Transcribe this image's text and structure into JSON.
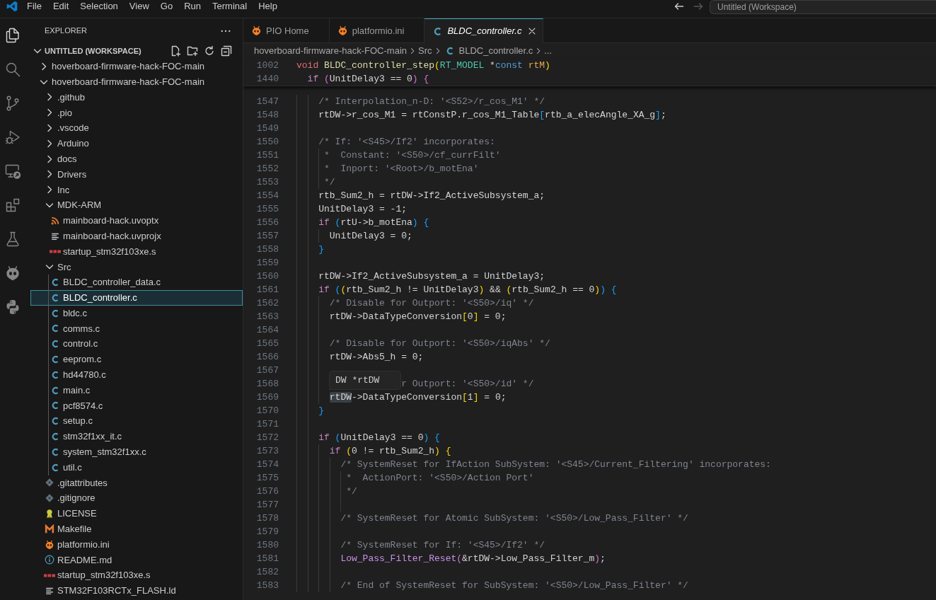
{
  "menu": [
    "File",
    "Edit",
    "Selection",
    "View",
    "Go",
    "Run",
    "Terminal",
    "Help"
  ],
  "navigation": [
    {
      "kind": "back",
      "disabled": false
    },
    {
      "kind": "forward",
      "disabled": true
    }
  ],
  "command_center": {
    "text": "Untitled (Workspace)"
  },
  "activity_bar": [
    {
      "kind": "explorer",
      "selected": true
    },
    {
      "kind": "search",
      "selected": false
    },
    {
      "kind": "source-control",
      "selected": false
    },
    {
      "kind": "run-debug",
      "selected": false
    },
    {
      "kind": "remote",
      "selected": false
    },
    {
      "kind": "extensions",
      "selected": false
    },
    {
      "kind": "testing",
      "selected": false
    },
    {
      "kind": "platformio",
      "selected": false
    },
    {
      "kind": "python",
      "selected": false
    }
  ],
  "sidebar": {
    "title": "EXPLORER",
    "workspace": {
      "label": "UNTITLED (WORKSPACE)",
      "expanded": true
    },
    "tree": [
      {
        "label": "hoverboard-firmware-hack-FOC-main",
        "kind": "folder",
        "expanded": false,
        "selected": false
      },
      {
        "label": "hoverboard-firmware-hack-FOC-main",
        "kind": "folder",
        "expanded": true,
        "selected": false,
        "children": [
          {
            "label": ".github",
            "kind": "folder",
            "expanded": false,
            "selected": false
          },
          {
            "label": ".pio",
            "kind": "folder",
            "expanded": false,
            "selected": false
          },
          {
            "label": ".vscode",
            "kind": "folder",
            "expanded": false,
            "selected": false
          },
          {
            "label": "Arduino",
            "kind": "folder",
            "expanded": false,
            "selected": false
          },
          {
            "label": "docs",
            "kind": "folder",
            "expanded": false,
            "selected": false
          },
          {
            "label": "Drivers",
            "kind": "folder",
            "expanded": false,
            "selected": false
          },
          {
            "label": "Inc",
            "kind": "folder",
            "expanded": false,
            "selected": false
          },
          {
            "label": "MDK-ARM",
            "kind": "folder",
            "expanded": true,
            "selected": false,
            "children": [
              {
                "label": "mainboard-hack.uvoptx",
                "kind": "feed",
                "selected": false
              },
              {
                "label": "mainboard-hack.uvprojx",
                "kind": "text",
                "selected": false
              },
              {
                "label": "startup_stm32f103xe.s",
                "kind": "asm",
                "selected": false
              }
            ]
          },
          {
            "label": "Src",
            "kind": "folder",
            "expanded": true,
            "selected": false,
            "children": [
              {
                "label": "BLDC_controller_data.c",
                "kind": "c",
                "selected": false
              },
              {
                "label": "BLDC_controller.c",
                "kind": "c",
                "selected": true
              },
              {
                "label": "bldc.c",
                "kind": "c",
                "selected": false
              },
              {
                "label": "comms.c",
                "kind": "c",
                "selected": false
              },
              {
                "label": "control.c",
                "kind": "c",
                "selected": false
              },
              {
                "label": "eeprom.c",
                "kind": "c",
                "selected": false
              },
              {
                "label": "hd44780.c",
                "kind": "c",
                "selected": false
              },
              {
                "label": "main.c",
                "kind": "c",
                "selected": false
              },
              {
                "label": "pcf8574.c",
                "kind": "c",
                "selected": false
              },
              {
                "label": "setup.c",
                "kind": "c",
                "selected": false
              },
              {
                "label": "stm32f1xx_it.c",
                "kind": "c",
                "selected": false
              },
              {
                "label": "system_stm32f1xx.c",
                "kind": "c",
                "selected": false
              },
              {
                "label": "util.c",
                "kind": "c",
                "selected": false
              }
            ]
          },
          {
            "label": ".gitattributes",
            "kind": "git",
            "selected": false
          },
          {
            "label": ".gitignore",
            "kind": "git",
            "selected": false
          },
          {
            "label": "LICENSE",
            "kind": "license",
            "selected": false
          },
          {
            "label": "Makefile",
            "kind": "makefile",
            "selected": false
          },
          {
            "label": "platformio.ini",
            "kind": "platformio",
            "selected": false
          },
          {
            "label": "README.md",
            "kind": "readme",
            "selected": false
          },
          {
            "label": "startup_stm32f103xe.s",
            "kind": "asm",
            "selected": false
          },
          {
            "label": "STM32F103RCTx_FLASH.ld",
            "kind": "text",
            "selected": false
          }
        ]
      }
    ]
  },
  "tabs": [
    {
      "label": "PIO Home",
      "kind": "platformio",
      "selected": false,
      "preview": false
    },
    {
      "label": "platformio.ini",
      "kind": "platformio",
      "selected": false,
      "preview": false
    },
    {
      "label": "BLDC_controller.c",
      "kind": "c",
      "selected": true,
      "preview": true
    }
  ],
  "breadcrumbs": [
    {
      "label": "hoverboard-firmware-hack-FOC-main",
      "kind": "folder"
    },
    {
      "label": "Src",
      "kind": "folder"
    },
    {
      "label": "BLDC_controller.c",
      "kind": "c"
    },
    {
      "label": "...",
      "kind": "ellipsis"
    }
  ],
  "editor": {
    "sticky_lines": [
      {
        "number": "1002",
        "segments": [
          {
            "kind": "primitive",
            "text": "void "
          },
          {
            "kind": "function",
            "text": "BLDC_controller_step"
          },
          {
            "kind": "bracket1",
            "text": "("
          },
          {
            "kind": "type",
            "text": "RT_MODEL"
          },
          {
            "kind": "plain",
            "text": " *"
          },
          {
            "kind": "storage",
            "text": "const "
          },
          {
            "kind": "parameter",
            "text": "rtM"
          },
          {
            "kind": "bracket1",
            "text": ")"
          }
        ]
      },
      {
        "number": "1440",
        "segments": [
          {
            "kind": "keyword",
            "text": "  if "
          },
          {
            "kind": "bracket2",
            "text": "("
          },
          {
            "kind": "plain",
            "text": "UnitDelay3 == 0"
          },
          {
            "kind": "bracket2",
            "text": ") {"
          }
        ]
      }
    ],
    "lines": [
      {
        "number": "1547",
        "segments": [
          {
            "kind": "comment",
            "text": "    /* Interpolation_n-D: '<S52>/r_cos_M1' */"
          }
        ]
      },
      {
        "number": "1548",
        "segments": [
          {
            "kind": "plain",
            "text": "    rtDW->r_cos_M1 = rtConstP.r_cos_M1_Table"
          },
          {
            "kind": "bracket3",
            "text": "["
          },
          {
            "kind": "plain",
            "text": "rtb_a_elecAngle_XA_g"
          },
          {
            "kind": "bracket3",
            "text": "]"
          },
          {
            "kind": "plain",
            "text": ";"
          }
        ]
      },
      {
        "number": "1549"
      },
      {
        "number": "1550",
        "segments": [
          {
            "kind": "comment",
            "text": "    /* If: '<S45>/If2' incorporates:"
          }
        ]
      },
      {
        "number": "1551",
        "segments": [
          {
            "kind": "comment",
            "text": "     *  Constant: '<S50>/cf_currFilt'"
          }
        ]
      },
      {
        "number": "1552",
        "segments": [
          {
            "kind": "comment",
            "text": "     *  Inport: '<Root>/b_motEna'"
          }
        ]
      },
      {
        "number": "1553",
        "segments": [
          {
            "kind": "comment",
            "text": "     */"
          }
        ]
      },
      {
        "number": "1554",
        "segments": [
          {
            "kind": "plain",
            "text": "    rtb_Sum2_h = rtDW->If2_ActiveSubsystem_a;"
          }
        ]
      },
      {
        "number": "1555",
        "segments": [
          {
            "kind": "plain",
            "text": "    UnitDelay3 = -1;"
          }
        ]
      },
      {
        "number": "1556",
        "segments": [
          {
            "kind": "keyword",
            "text": "    if "
          },
          {
            "kind": "bracket3",
            "text": "("
          },
          {
            "kind": "plain",
            "text": "rtU->b_motEna"
          },
          {
            "kind": "bracket3",
            "text": ") {"
          }
        ]
      },
      {
        "number": "1557",
        "segments": [
          {
            "kind": "plain",
            "text": "      UnitDelay3 = 0;"
          }
        ]
      },
      {
        "number": "1558",
        "segments": [
          {
            "kind": "bracket3",
            "text": "    }"
          }
        ]
      },
      {
        "number": "1559"
      },
      {
        "number": "1560",
        "segments": [
          {
            "kind": "plain",
            "text": "    rtDW->If2_ActiveSubsystem_a = UnitDelay3;"
          }
        ]
      },
      {
        "number": "1561",
        "segments": [
          {
            "kind": "keyword",
            "text": "    if "
          },
          {
            "kind": "bracket3",
            "text": "("
          },
          {
            "kind": "bracket1",
            "text": "("
          },
          {
            "kind": "plain",
            "text": "rtb_Sum2_h != UnitDelay3"
          },
          {
            "kind": "bracket1",
            "text": ")"
          },
          {
            "kind": "plain",
            "text": " && "
          },
          {
            "kind": "bracket1",
            "text": "("
          },
          {
            "kind": "plain",
            "text": "rtb_Sum2_h == 0"
          },
          {
            "kind": "bracket1",
            "text": ")"
          },
          {
            "kind": "bracket3",
            "text": ") {"
          }
        ]
      },
      {
        "number": "1562",
        "segments": [
          {
            "kind": "comment",
            "text": "      /* Disable for Outport: '<S50>/iq' */"
          }
        ]
      },
      {
        "number": "1563",
        "segments": [
          {
            "kind": "plain",
            "text": "      rtDW->DataTypeConversion"
          },
          {
            "kind": "bracket1",
            "text": "["
          },
          {
            "kind": "plain",
            "text": "0"
          },
          {
            "kind": "bracket1",
            "text": "]"
          },
          {
            "kind": "plain",
            "text": " = 0;"
          }
        ]
      },
      {
        "number": "1564"
      },
      {
        "number": "1565",
        "segments": [
          {
            "kind": "comment",
            "text": "      /* Disable for Outport: '<S50>/iqAbs' */"
          }
        ]
      },
      {
        "number": "1566",
        "segments": [
          {
            "kind": "plain",
            "text": "      rtDW->Abs5_h = 0;"
          }
        ]
      },
      {
        "number": "1567"
      },
      {
        "number": "1568",
        "segments": [
          {
            "kind": "comment",
            "text": "                   r Outport: '<S50>/id' */"
          }
        ],
        "tooltip": "DW *rtDW"
      },
      {
        "number": "1569",
        "segments": [
          {
            "kind": "hover",
            "text": "      rtDW"
          },
          {
            "kind": "plain",
            "text": "->DataTypeConversion"
          },
          {
            "kind": "bracket1",
            "text": "["
          },
          {
            "kind": "plain",
            "text": "1"
          },
          {
            "kind": "bracket1",
            "text": "]"
          },
          {
            "kind": "plain",
            "text": " = 0;"
          }
        ]
      },
      {
        "number": "1570",
        "segments": [
          {
            "kind": "bracket3",
            "text": "    }"
          }
        ]
      },
      {
        "number": "1571"
      },
      {
        "number": "1572",
        "segments": [
          {
            "kind": "keyword",
            "text": "    if "
          },
          {
            "kind": "bracket3",
            "text": "("
          },
          {
            "kind": "plain",
            "text": "UnitDelay3 == 0"
          },
          {
            "kind": "bracket3",
            "text": ") {"
          }
        ]
      },
      {
        "number": "1573",
        "segments": [
          {
            "kind": "keyword",
            "text": "      if "
          },
          {
            "kind": "bracket1",
            "text": "("
          },
          {
            "kind": "plain",
            "text": "0 != rtb_Sum2_h"
          },
          {
            "kind": "bracket1",
            "text": ") {"
          }
        ]
      },
      {
        "number": "1574",
        "segments": [
          {
            "kind": "comment",
            "text": "        /* SystemReset for IfAction SubSystem: '<S45>/Current_Filtering' incorporates:"
          }
        ]
      },
      {
        "number": "1575",
        "segments": [
          {
            "kind": "comment",
            "text": "         *  ActionPort: '<S50>/Action Port'"
          }
        ]
      },
      {
        "number": "1576",
        "segments": [
          {
            "kind": "comment",
            "text": "         */"
          }
        ]
      },
      {
        "number": "1577"
      },
      {
        "number": "1578",
        "segments": [
          {
            "kind": "comment",
            "text": "        /* SystemReset for Atomic SubSystem: '<S50>/Low_Pass_Filter' */"
          }
        ]
      },
      {
        "number": "1579"
      },
      {
        "number": "1580",
        "segments": [
          {
            "kind": "comment",
            "text": "        /* SystemReset for If: '<S45>/If2' */"
          }
        ]
      },
      {
        "number": "1581",
        "segments": [
          {
            "kind": "call",
            "text": "        Low_Pass_Filter_Reset"
          },
          {
            "kind": "bracket2",
            "text": "("
          },
          {
            "kind": "plain",
            "text": "&rtDW->Low_Pass_Filter_m"
          },
          {
            "kind": "bracket2",
            "text": ")"
          },
          {
            "kind": "plain",
            "text": ";"
          }
        ]
      },
      {
        "number": "1582"
      },
      {
        "number": "1583",
        "segments": [
          {
            "kind": "comment",
            "text": "        /* End of SystemReset for SubSystem: '<S50>/Low_Pass_Filter' */"
          }
        ]
      }
    ]
  }
}
